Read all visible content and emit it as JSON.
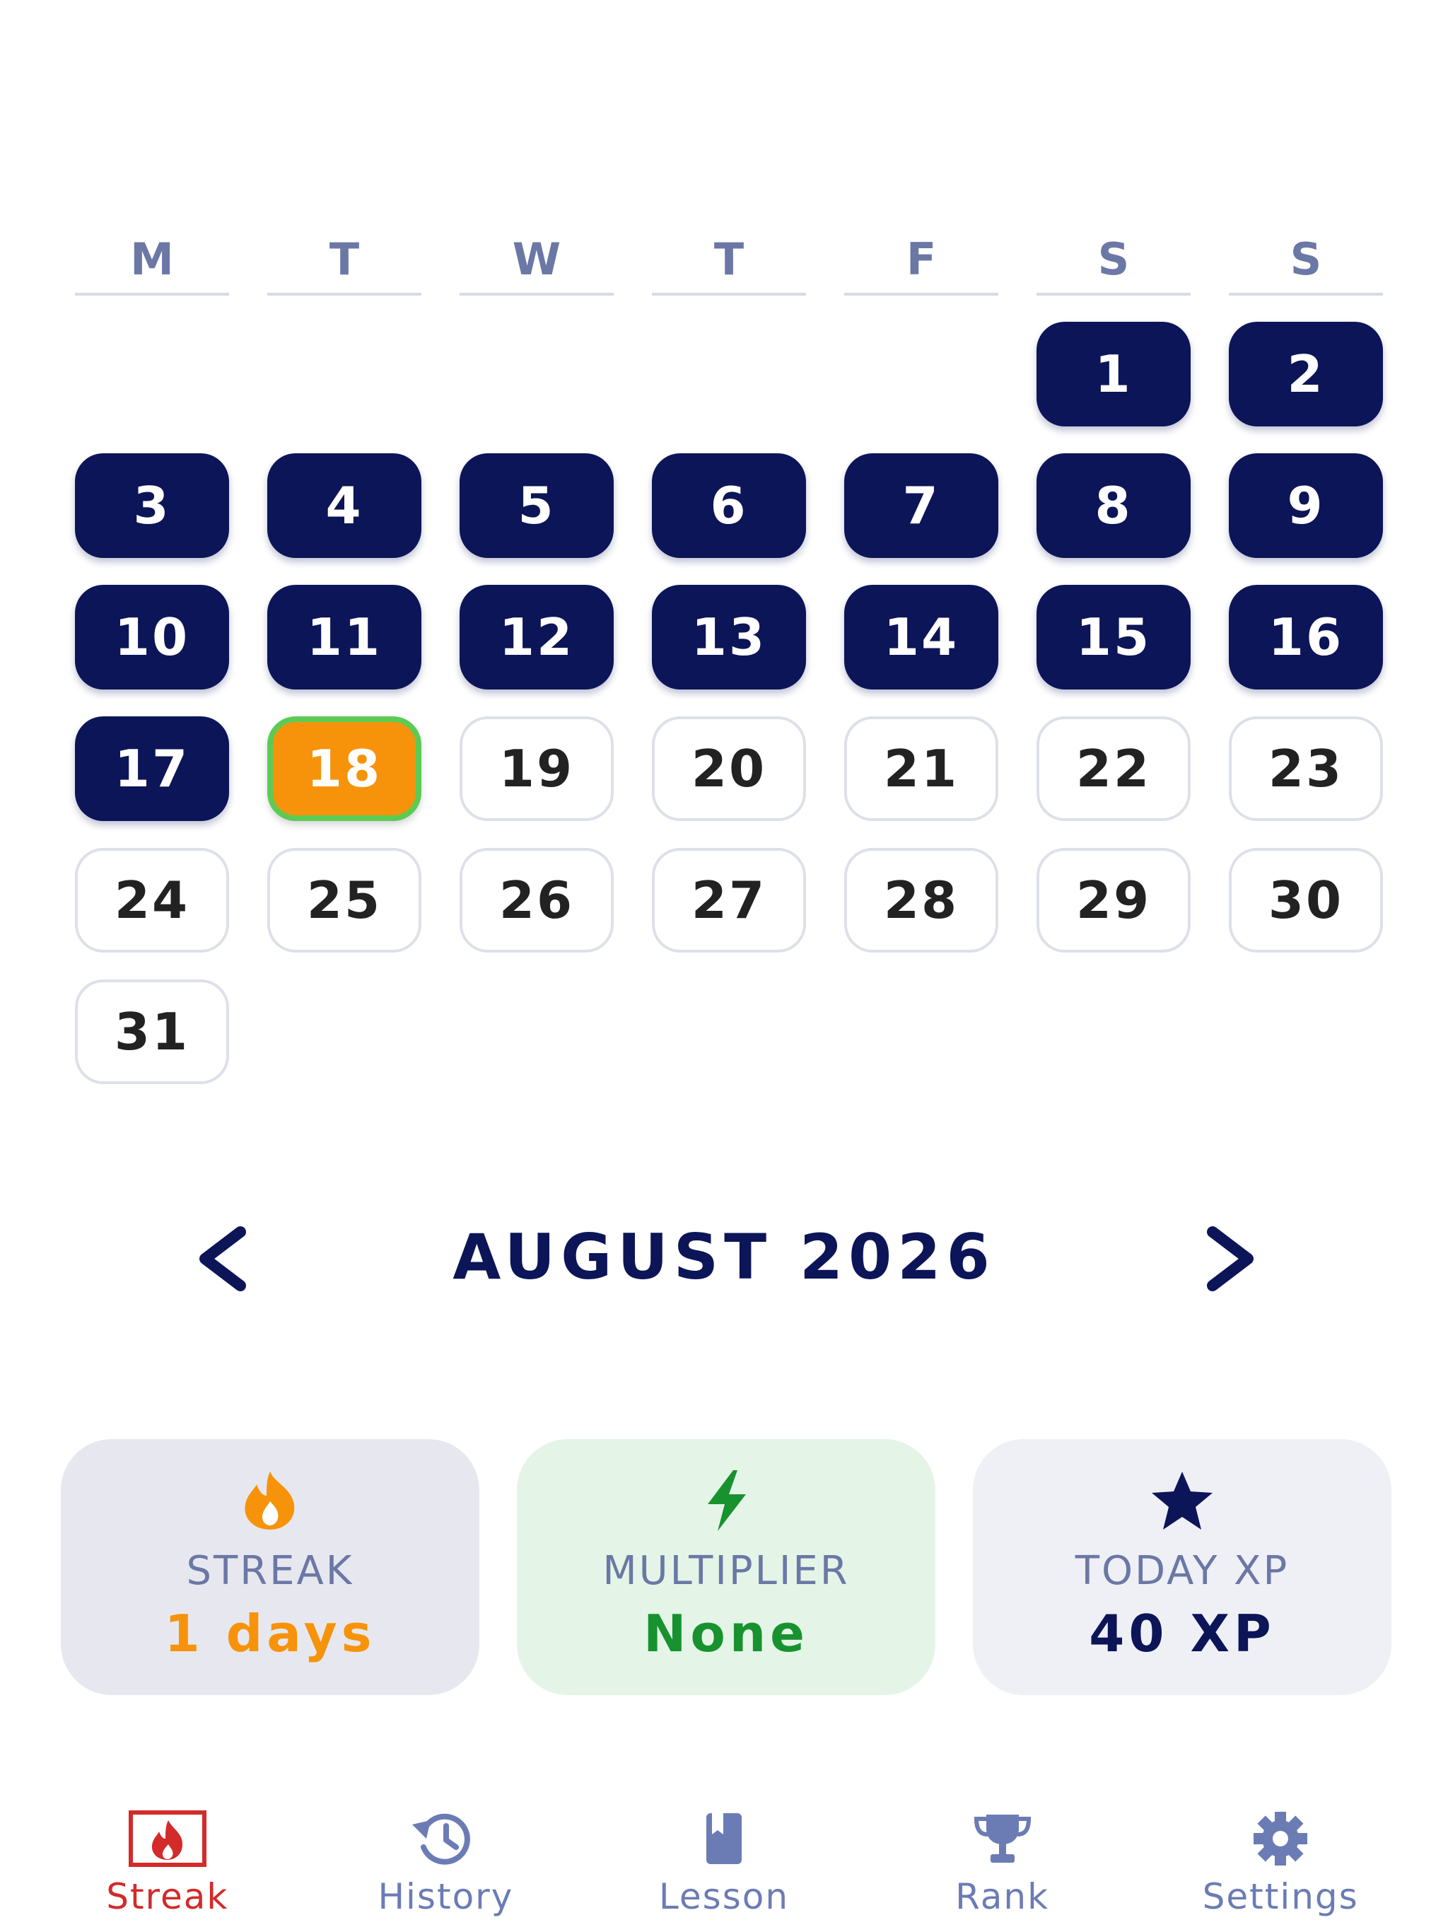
{
  "calendar": {
    "weekdays": [
      "M",
      "T",
      "W",
      "T",
      "F",
      "S",
      "S"
    ],
    "leading_blank_days": 5,
    "days": [
      {
        "label": "1",
        "status": "done"
      },
      {
        "label": "2",
        "status": "done"
      },
      {
        "label": "3",
        "status": "done"
      },
      {
        "label": "4",
        "status": "done"
      },
      {
        "label": "5",
        "status": "done"
      },
      {
        "label": "6",
        "status": "done"
      },
      {
        "label": "7",
        "status": "done"
      },
      {
        "label": "8",
        "status": "done"
      },
      {
        "label": "9",
        "status": "done"
      },
      {
        "label": "10",
        "status": "done"
      },
      {
        "label": "11",
        "status": "done"
      },
      {
        "label": "12",
        "status": "done"
      },
      {
        "label": "13",
        "status": "done"
      },
      {
        "label": "14",
        "status": "done"
      },
      {
        "label": "15",
        "status": "done"
      },
      {
        "label": "16",
        "status": "done"
      },
      {
        "label": "17",
        "status": "done"
      },
      {
        "label": "18",
        "status": "today"
      },
      {
        "label": "19",
        "status": "future"
      },
      {
        "label": "20",
        "status": "future"
      },
      {
        "label": "21",
        "status": "future"
      },
      {
        "label": "22",
        "status": "future"
      },
      {
        "label": "23",
        "status": "future"
      },
      {
        "label": "24",
        "status": "future"
      },
      {
        "label": "25",
        "status": "future"
      },
      {
        "label": "26",
        "status": "future"
      },
      {
        "label": "27",
        "status": "future"
      },
      {
        "label": "28",
        "status": "future"
      },
      {
        "label": "29",
        "status": "future"
      },
      {
        "label": "30",
        "status": "future"
      },
      {
        "label": "31",
        "status": "future"
      }
    ],
    "month_label": "AUGUST 2026",
    "prev_icon": "chevron-left-icon",
    "next_icon": "chevron-right-icon"
  },
  "stats": {
    "streak": {
      "icon": "fire-icon",
      "label": "STREAK",
      "value": "1 days"
    },
    "multiplier": {
      "icon": "lightning-bolt-icon",
      "label": "MULTIPLIER",
      "value": "None"
    },
    "today_xp": {
      "icon": "star-icon",
      "label": "TODAY XP",
      "value": "40 XP"
    }
  },
  "bottom_nav": {
    "items": [
      {
        "label": "Streak",
        "icon": "streak-fire-icon",
        "active": true
      },
      {
        "label": "History",
        "icon": "history-icon",
        "active": false
      },
      {
        "label": "Lesson",
        "icon": "book-icon",
        "active": false
      },
      {
        "label": "Rank",
        "icon": "trophy-icon",
        "active": false
      },
      {
        "label": "Settings",
        "icon": "gear-icon",
        "active": false
      }
    ]
  },
  "colors": {
    "done_day": "#0c1557",
    "today_fill": "#f7930a",
    "today_border": "#5ccb55",
    "muted_text": "#6b78a6",
    "active_nav": "#d32a2a",
    "nav_icon": "#6b7cb5"
  }
}
